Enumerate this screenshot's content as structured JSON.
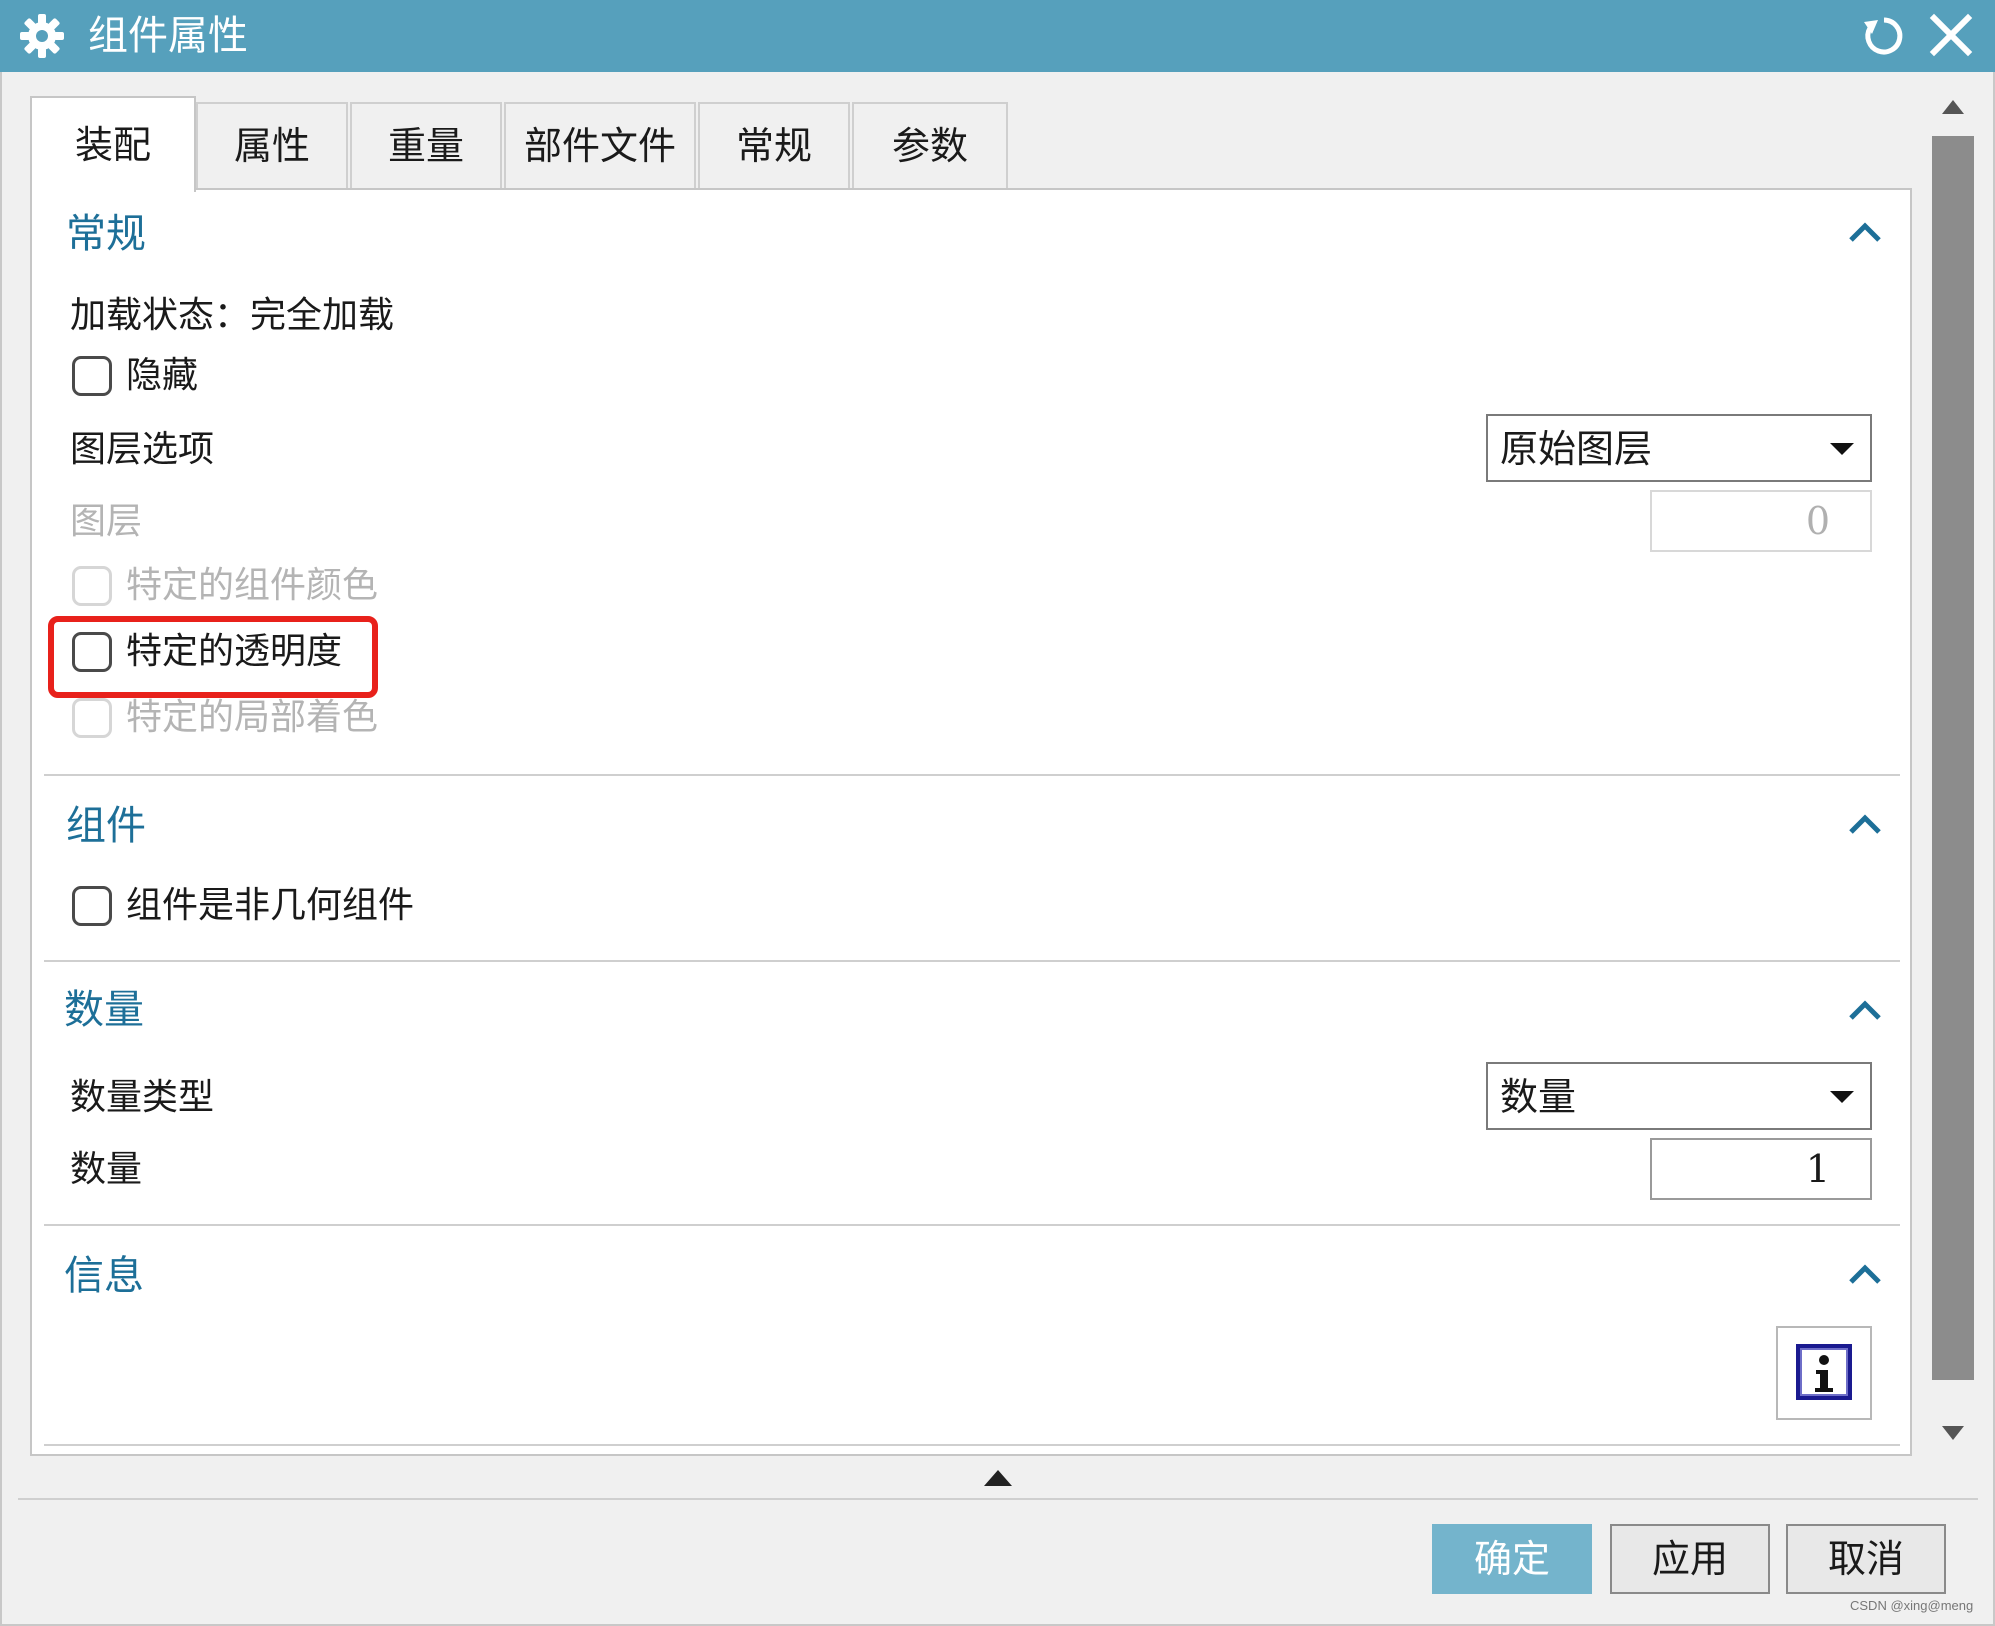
{
  "window": {
    "title": "组件属性",
    "icons": {
      "app": "gear-icon",
      "reset": "reset-icon",
      "close": "close-icon"
    },
    "colors": {
      "titlebar": "#56a0bc",
      "section_title": "#1d6f98",
      "highlight": "#e8211b",
      "primary_button": "#74b4cc"
    }
  },
  "tabs": [
    {
      "label": "装配",
      "active": true
    },
    {
      "label": "属性",
      "active": false
    },
    {
      "label": "重量",
      "active": false
    },
    {
      "label": "部件文件",
      "active": false
    },
    {
      "label": "常规",
      "active": false
    },
    {
      "label": "参数",
      "active": false
    }
  ],
  "sections": {
    "general": {
      "title": "常规",
      "load_state": "加载状态：完全加载",
      "hide_label": "隐藏",
      "layer_option_label": "图层选项",
      "layer_option_value": "原始图层",
      "layer_label": "图层",
      "layer_value": "0",
      "specific_color_label": "特定的组件颜色",
      "specific_transparency_label": "特定的透明度",
      "specific_partial_shading_label": "特定的局部着色"
    },
    "component": {
      "title": "组件",
      "non_geometric_label": "组件是非几何组件"
    },
    "quantity": {
      "title": "数量",
      "type_label": "数量类型",
      "type_value": "数量",
      "quantity_label": "数量",
      "quantity_value": "1"
    },
    "info": {
      "title": "信息",
      "info_icon": "info-icon"
    }
  },
  "buttons": {
    "ok": "确定",
    "apply": "应用",
    "cancel": "取消"
  },
  "watermark": "CSDN @xing@meng"
}
